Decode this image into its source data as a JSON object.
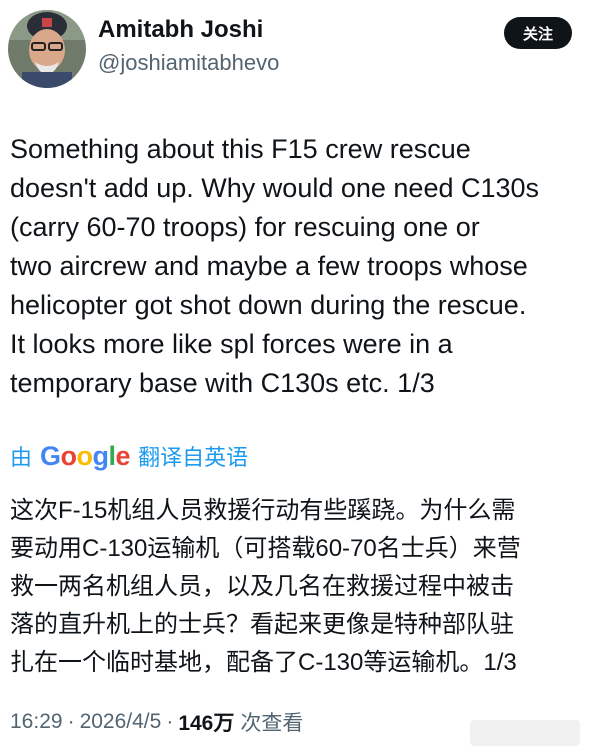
{
  "author": {
    "display_name": "Amitabh Joshi",
    "handle": "@joshiamitabhevo"
  },
  "follow_button": {
    "label": "关注"
  },
  "tweet": {
    "text": "Something about this F15 crew rescue\ndoesn't add up. Why would one need C130s\n(carry 60-70 troops) for rescuing one or\ntwo aircrew and maybe a few troops whose\nhelicopter got shot down during the rescue.\nIt looks more like spl forces were in a\ntemporary base with C130s etc. 1/3"
  },
  "translation": {
    "by_label": "由",
    "google_letters": [
      {
        "char": "G",
        "color": "#4285F4"
      },
      {
        "char": "o",
        "color": "#EA4335"
      },
      {
        "char": "o",
        "color": "#FBBC05"
      },
      {
        "char": "g",
        "color": "#4285F4"
      },
      {
        "char": "l",
        "color": "#34A853"
      },
      {
        "char": "e",
        "color": "#EA4335"
      }
    ],
    "from_label": "翻译自英语",
    "text": "这次F-15机组人员救援行动有些蹊跷。为什么需\n要动用C-130运输机（可搭载60-70名士兵）来营\n救一两名机组人员，以及几名在救援过程中被击\n落的直升机上的士兵？看起来更像是特种部队驻\n扎在一个临时基地，配备了C-130等运输机。1/3"
  },
  "meta": {
    "time": "16:29",
    "separator": "·",
    "date": "2026/4/5",
    "views_count": "146万",
    "views_label": "次查看"
  },
  "colors": {
    "accent": "#1d9bf0",
    "text": "#0f1419",
    "secondary": "#536471",
    "follow_bg": "#0f1419"
  }
}
